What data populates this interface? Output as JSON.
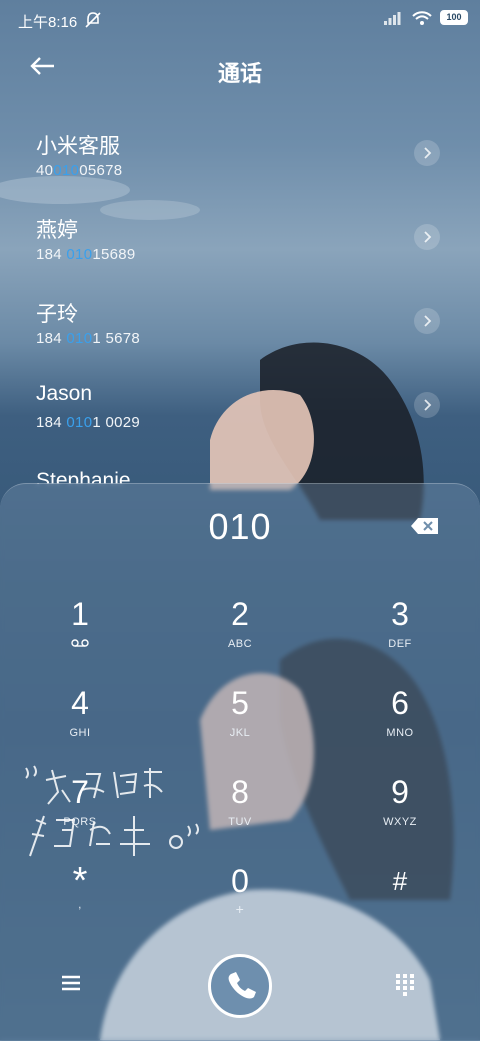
{
  "status_bar": {
    "time": "上午8:16",
    "battery": "100"
  },
  "header": {
    "title": "通话"
  },
  "contacts": [
    {
      "name": "小米客服",
      "number_pre": "40",
      "number_match": "010",
      "number_post": "05678"
    },
    {
      "name": "燕婷",
      "number_pre": "184 ",
      "number_match": "010",
      "number_post": "15689"
    },
    {
      "name": "子玲",
      "number_pre": "184 ",
      "number_match": "010",
      "number_post": "1 5678"
    },
    {
      "name": "Jason",
      "number_pre": "184 ",
      "number_match": "010",
      "number_post": "1 0029"
    }
  ],
  "partial_contact": "Stephanie",
  "dialer": {
    "input": "010",
    "keys": [
      {
        "digit": "1",
        "letters": ""
      },
      {
        "digit": "2",
        "letters": "ABC"
      },
      {
        "digit": "3",
        "letters": "DEF"
      },
      {
        "digit": "4",
        "letters": "GHI"
      },
      {
        "digit": "5",
        "letters": "JKL"
      },
      {
        "digit": "6",
        "letters": "MNO"
      },
      {
        "digit": "7",
        "letters": "PQRS"
      },
      {
        "digit": "8",
        "letters": "TUV"
      },
      {
        "digit": "9",
        "letters": "WXYZ"
      },
      {
        "digit": "*",
        "letters": ","
      },
      {
        "digit": "0",
        "letters": "+"
      },
      {
        "digit": "#",
        "letters": ""
      }
    ]
  },
  "colors": {
    "match_highlight": "#3aa0ec",
    "call_button": "#6e8fae"
  },
  "icons": {
    "back": "arrow-left-icon",
    "backspace": "backspace-icon",
    "voicemail": "voicemail-icon",
    "menu": "menu-icon",
    "call": "phone-icon",
    "keypad": "keypad-icon"
  }
}
